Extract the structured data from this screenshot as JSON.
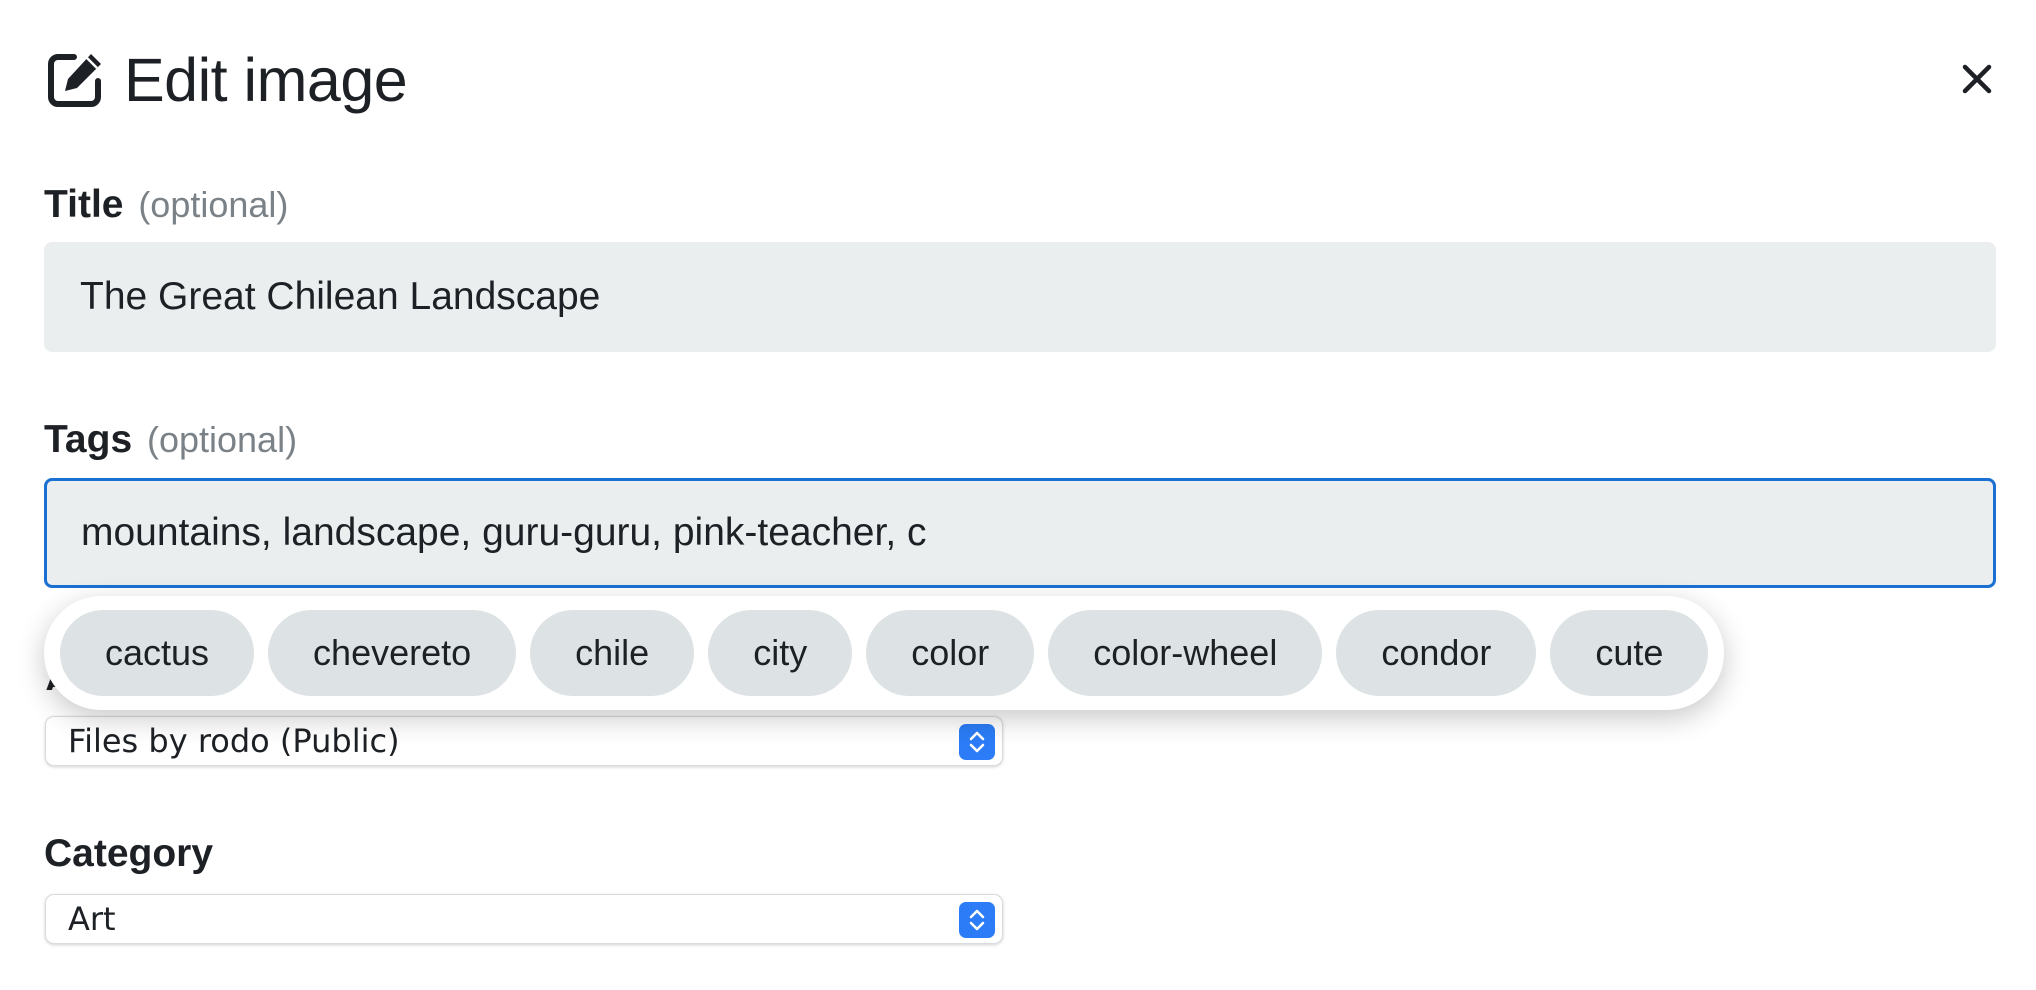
{
  "header": {
    "title": "Edit image",
    "edit_icon": "edit-square-icon",
    "close_icon": "close-icon"
  },
  "title_field": {
    "label": "Title",
    "optional": "(optional)",
    "value": "The Great Chilean Landscape"
  },
  "tags_field": {
    "label": "Tags",
    "optional": "(optional)",
    "value": "mountains, landscape, guru-guru, pink-teacher, c"
  },
  "tag_suggestions": [
    "cactus",
    "chevereto",
    "chile",
    "city",
    "color",
    "color-wheel",
    "condor",
    "cute"
  ],
  "album_field": {
    "selected": "Files by rodo (Public)"
  },
  "category_field": {
    "label": "Category",
    "selected": "Art"
  },
  "colors": {
    "focus_border": "#1a70d2",
    "input_background": "#eaeeef",
    "chip_background": "#dde2e4",
    "select_arrow": "#2b7cf6"
  }
}
